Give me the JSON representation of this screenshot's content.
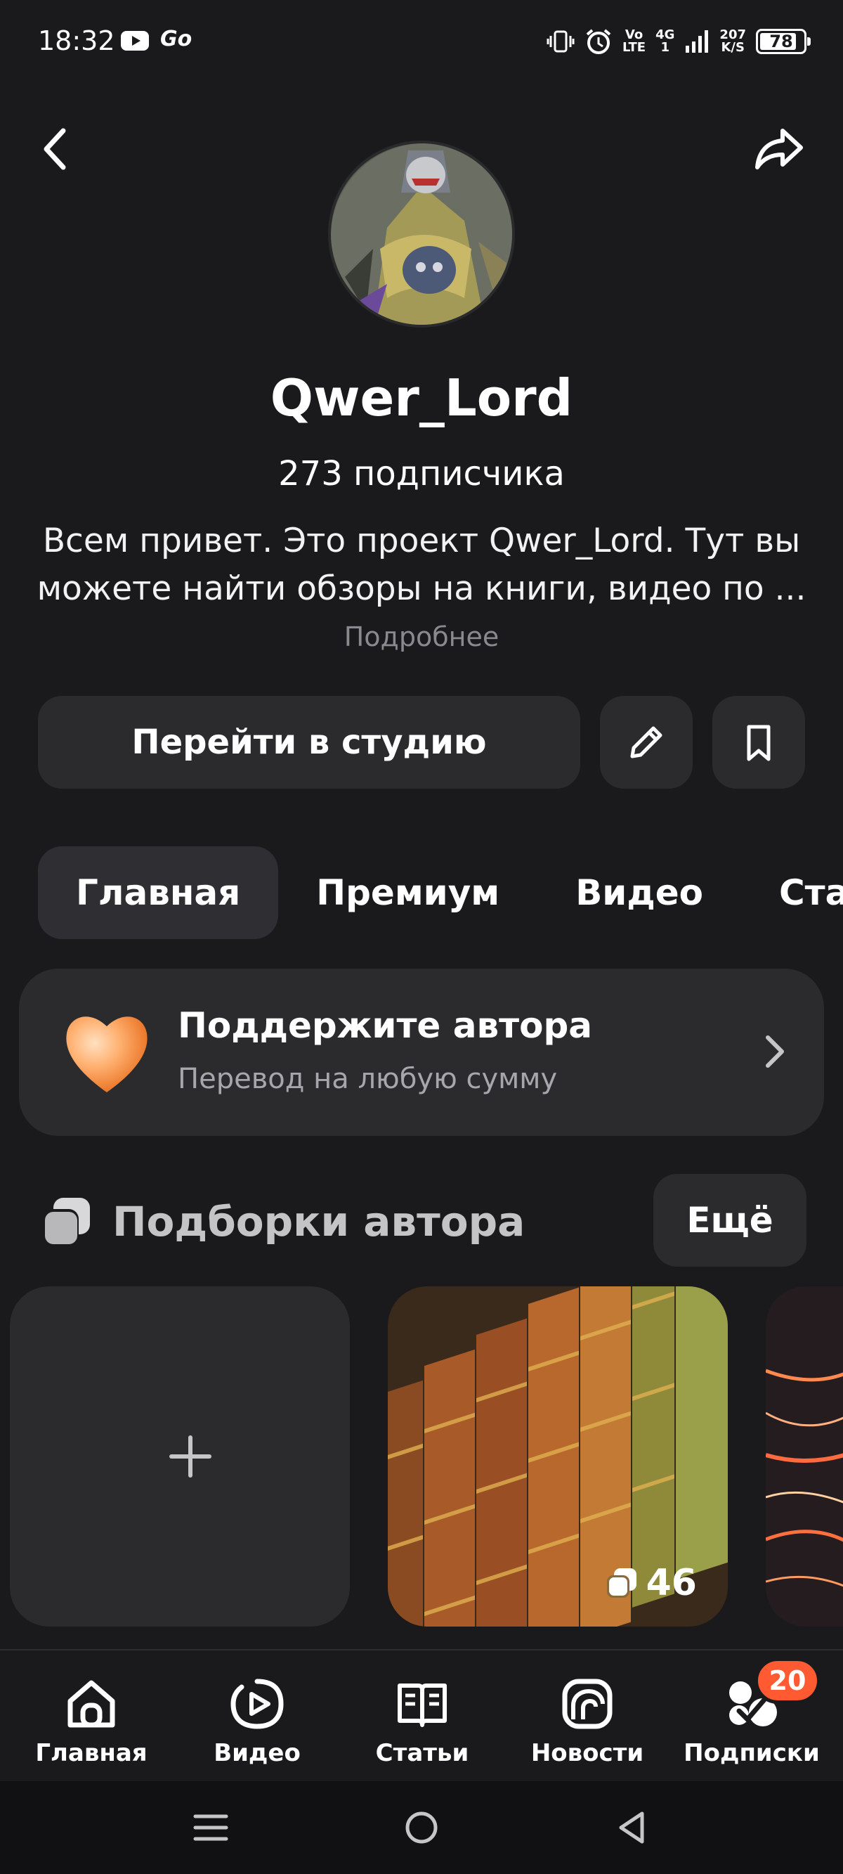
{
  "status_bar": {
    "time": "18:32",
    "go_label": "Go",
    "volte_top": "Vo",
    "volte_bottom": "LTE",
    "network": "4G",
    "network_sub": "1",
    "speed_top": "207",
    "speed_bottom": "K/S",
    "battery": "78",
    "icons": [
      "youtube-icon",
      "go-icon",
      "vibrate-icon",
      "alarm-icon",
      "signal-icon",
      "battery-icon"
    ]
  },
  "header": {
    "back_icon": "back-arrow-icon",
    "share_icon": "share-icon"
  },
  "profile": {
    "name": "Qwer_Lord",
    "subscribers": "273 подписчика",
    "description": "Всем привет. Это проект Qwer_Lord. Тут вы можете найти обзоры на книги, видео по ...",
    "more_label": "Подробнее"
  },
  "actions": {
    "studio_label": "Перейти в студию",
    "edit_icon": "pencil-icon",
    "bookmark_icon": "bookmark-icon"
  },
  "tabs": [
    {
      "label": "Главная",
      "active": true
    },
    {
      "label": "Премиум",
      "active": false
    },
    {
      "label": "Видео",
      "active": false
    },
    {
      "label": "Статьи",
      "active": false
    }
  ],
  "support": {
    "title": "Поддержите автора",
    "subtitle": "Перевод на любую сумму",
    "icon": "heart-icon",
    "chevron": "chevron-right-icon"
  },
  "collections": {
    "title": "Подборки автора",
    "more_label": "Ещё",
    "cards": [
      {
        "type": "add",
        "icon": "plus-icon"
      },
      {
        "type": "collection",
        "count": "46",
        "image": "books"
      },
      {
        "type": "collection",
        "image": "light-trails"
      }
    ]
  },
  "bottom_nav": {
    "items": [
      {
        "label": "Главная",
        "icon": "home-icon"
      },
      {
        "label": "Видео",
        "icon": "video-icon"
      },
      {
        "label": "Статьи",
        "icon": "articles-icon"
      },
      {
        "label": "Новости",
        "icon": "news-icon"
      },
      {
        "label": "Подписки",
        "icon": "subscriptions-icon"
      }
    ],
    "badge": "20"
  },
  "system_nav": [
    "menu-icon",
    "home-circle-icon",
    "back-triangle-icon"
  ],
  "colors": {
    "background": "#1a1a1c",
    "surface": "#2b2b2e",
    "badge": "#ff5a32",
    "secondary_text": "#a7a7ab"
  }
}
